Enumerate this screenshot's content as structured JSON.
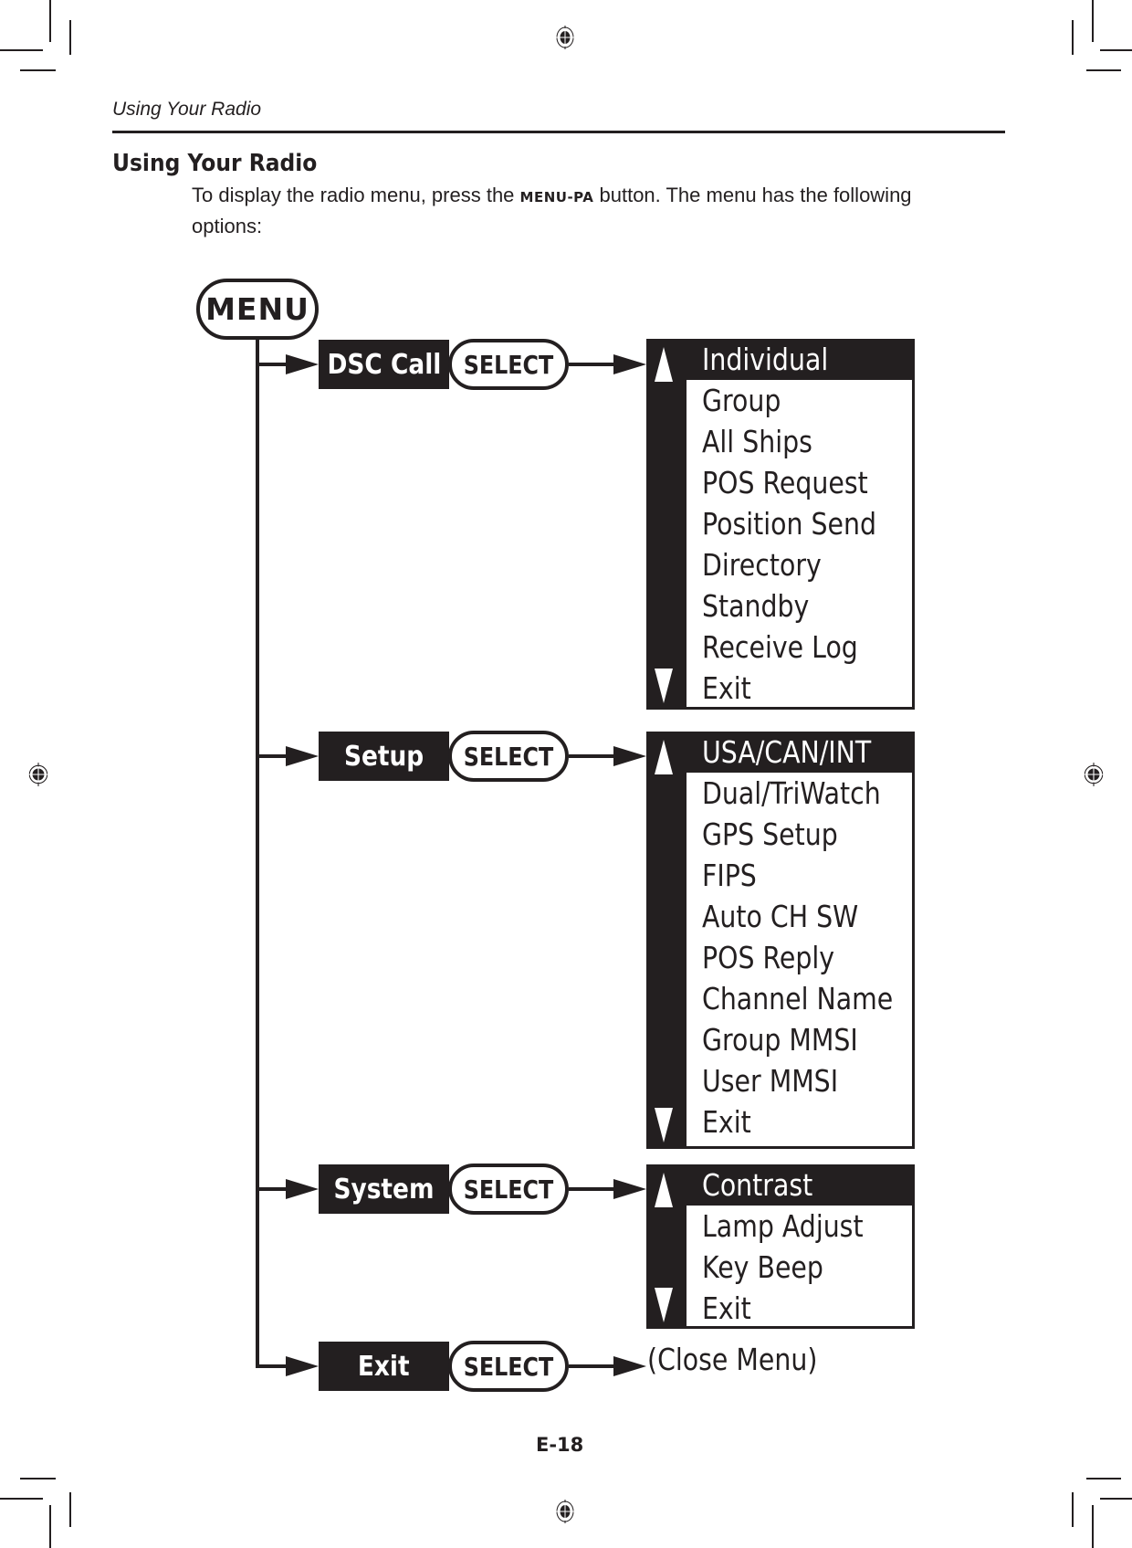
{
  "page": {
    "running_head": "Using Your Radio",
    "heading": "Using Your Radio",
    "intro": {
      "before": "To display the radio menu, press the ",
      "key": "MENU-PA",
      "after": " button. The menu has the following options:"
    },
    "page_number": "E-18"
  },
  "diagram": {
    "root": "MENU",
    "select_label": "SELECT",
    "branches": [
      {
        "label": "DSC Call",
        "items": [
          "Individual",
          "Group",
          "All Ships",
          "POS Request",
          "Position Send",
          "Directory",
          "Standby",
          "Receive Log",
          "Exit"
        ],
        "selected": "Individual"
      },
      {
        "label": "Setup",
        "items": [
          "USA/CAN/INT",
          "Dual/TriWatch",
          "GPS Setup",
          "FIPS",
          "Auto CH SW",
          "POS Reply",
          "Channel Name",
          "Group MMSI",
          "User MMSI",
          "Exit"
        ],
        "selected": "USA/CAN/INT"
      },
      {
        "label": "System",
        "items": [
          "Contrast",
          "Lamp Adjust",
          "Key Beep",
          "Exit"
        ],
        "selected": "Contrast"
      },
      {
        "label": "Exit",
        "result": "(Close Menu)"
      }
    ]
  },
  "icons": {
    "registration_mark": "crosshair-circle",
    "scroll_up": "triangle-up",
    "scroll_down": "triangle-down",
    "connector": "arrow-right"
  }
}
